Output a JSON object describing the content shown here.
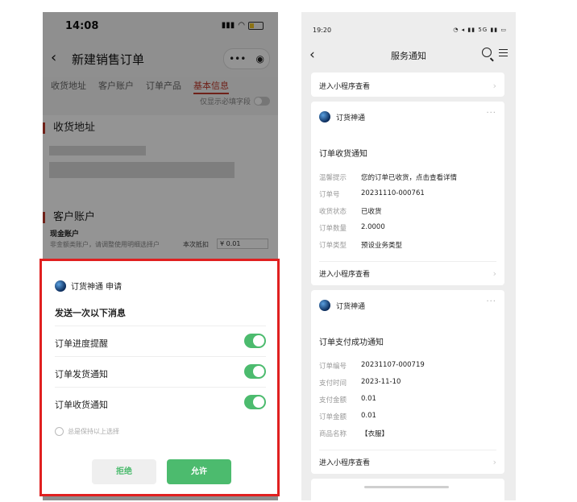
{
  "left_phone": {
    "status": {
      "time": "14:08"
    },
    "nav": {
      "title": "新建销售订单",
      "capsule_more": "•••",
      "capsule_close": "◉"
    },
    "tabs": [
      "收货地址",
      "客户账户",
      "订单产品",
      "基本信息"
    ],
    "active_tab_index": 3,
    "required_only_label": "仅显示必填字段",
    "section_address": "收货地址",
    "section_account": "客户账户",
    "cash_account_label": "现金账户",
    "cash_account_desc": "非金额类账户，请调整使用明细选择户",
    "this_use_label": "本次抵扣",
    "cash_input_value": "¥ 0.01",
    "sheet": {
      "app_name": "订货神通 申请",
      "title": "发送一次以下消息",
      "permissions": [
        {
          "label": "订单进度提醒",
          "enabled": true
        },
        {
          "label": "订单发货通知",
          "enabled": true
        },
        {
          "label": "订单收货通知",
          "enabled": true
        }
      ],
      "always_keep": "总是保持以上选择",
      "deny": "拒绝",
      "allow": "允许"
    },
    "colors": {
      "accent_green": "#4cbb6e",
      "highlight_red": "#e02020",
      "tab_red": "#c0392b"
    }
  },
  "right_phone": {
    "status": {
      "time": "19:20",
      "icons": "◔ ◂ ▮▮ 5G ▮▮ ▭"
    },
    "nav": {
      "title": "服务通知"
    },
    "top_link": "进入小程序查看",
    "cards": [
      {
        "app_name": "订货神通",
        "title": "订单收货通知",
        "fields": [
          {
            "k": "温馨提示",
            "v": "您的订单已收货，点击查看详情"
          },
          {
            "k": "订单号",
            "v": "20231110-000761"
          },
          {
            "k": "收货状态",
            "v": "已收货"
          },
          {
            "k": "订单数量",
            "v": "2.0000"
          },
          {
            "k": "订单类型",
            "v": "预设业务类型"
          }
        ],
        "link": "进入小程序查看"
      },
      {
        "app_name": "订货神通",
        "title": "订单支付成功通知",
        "fields": [
          {
            "k": "订单编号",
            "v": "20231107-000719"
          },
          {
            "k": "支付时间",
            "v": "2023-11-10"
          },
          {
            "k": "支付金额",
            "v": "0.01"
          },
          {
            "k": "订单金额",
            "v": "0.01"
          },
          {
            "k": "商品名称",
            "v": "【衣服】"
          }
        ],
        "link": "进入小程序查看"
      }
    ],
    "more_dots": "···",
    "chevron": "›"
  }
}
